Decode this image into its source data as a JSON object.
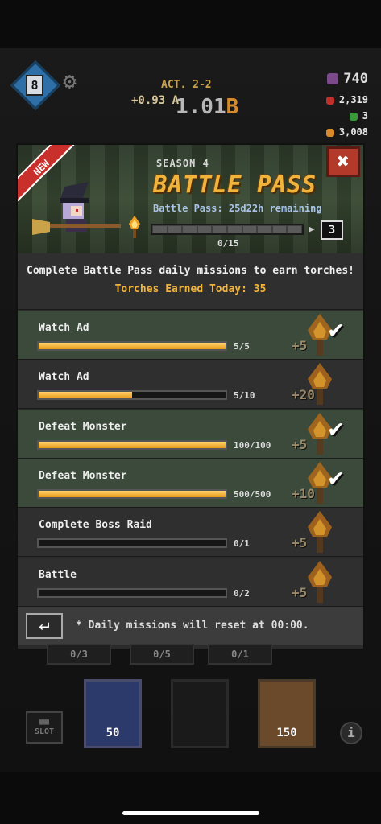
{
  "hud": {
    "floor": "8",
    "act": "ACT. 2-2",
    "gold_rate": "+0.93 A",
    "gold_total": "1.01",
    "gold_unit": "B",
    "resource_main": "740",
    "resources": [
      "2,319",
      "3",
      "3,008"
    ]
  },
  "header": {
    "new_label": "NEW",
    "season": "SEASON 4",
    "title": "BATTLE PASS",
    "remaining": "Battle Pass: 25d22h remaining",
    "progress_text": "0/15",
    "level": "3",
    "close_label": "✖"
  },
  "info": {
    "line1": "Complete Battle Pass daily missions to earn torches!",
    "line2": "Torches Earned Today: 35"
  },
  "missions": [
    {
      "name": "Watch Ad",
      "count": "5/5",
      "reward": "+5",
      "progress": 1.0,
      "done": true
    },
    {
      "name": "Watch Ad",
      "count": "5/10",
      "reward": "+20",
      "progress": 0.5,
      "done": false
    },
    {
      "name": "Defeat Monster",
      "count": "100/100",
      "reward": "+5",
      "progress": 1.0,
      "done": true
    },
    {
      "name": "Defeat Monster",
      "count": "500/500",
      "reward": "+10",
      "progress": 1.0,
      "done": true
    },
    {
      "name": "Complete Boss Raid",
      "count": "0/1",
      "reward": "+5",
      "progress": 0.0,
      "done": false
    },
    {
      "name": "Battle",
      "count": "0/2",
      "reward": "+5",
      "progress": 0.0,
      "done": false
    }
  ],
  "footer": {
    "back_label": "↵",
    "note": "* Daily missions will reset at 00:00."
  },
  "bottom": {
    "tabs": [
      "0/3",
      "0/5",
      "0/1"
    ],
    "card_left": "50",
    "card_right": "150",
    "slot_label": "SLOT",
    "info_label": "i"
  }
}
